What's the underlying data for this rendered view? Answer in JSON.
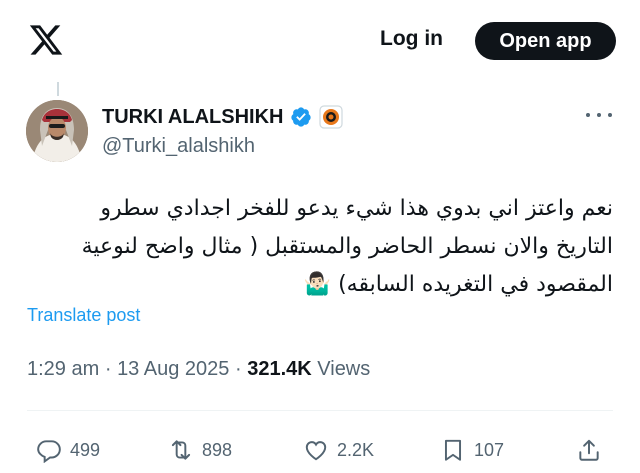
{
  "header": {
    "logo_icon": "x-logo-icon",
    "login_label": "Log in",
    "open_app_label": "Open app"
  },
  "tweet": {
    "author": {
      "display_name": "TURKI ALALSHIKH",
      "handle": "@Turki_alalshikh",
      "verified_badge_color": "#1d9bf0",
      "affiliate_badge_color": "#e8781a"
    },
    "text_line_1": "نعم واعتز اني بدوي هذا شيء يدعو للفخر اجدادي سطرو",
    "text_line_2": "التاريخ والان نسطر الحاضر والمستقبل ( مثال واضح لنوعية",
    "text_line_3": "المقصود في التغريده السابقه)",
    "emoji": "🤷🏻‍♂️",
    "translate_label": "Translate post",
    "time": "1:29 am",
    "separator": "·",
    "date": "13 Aug 2025",
    "views_count": "321.4K",
    "views_label": "Views"
  },
  "actions": {
    "replies": "499",
    "reposts": "898",
    "likes": "2.2K",
    "bookmarks": "107"
  },
  "colors": {
    "text_primary": "#0f1419",
    "text_secondary": "#536471",
    "link": "#1d9bf0"
  }
}
